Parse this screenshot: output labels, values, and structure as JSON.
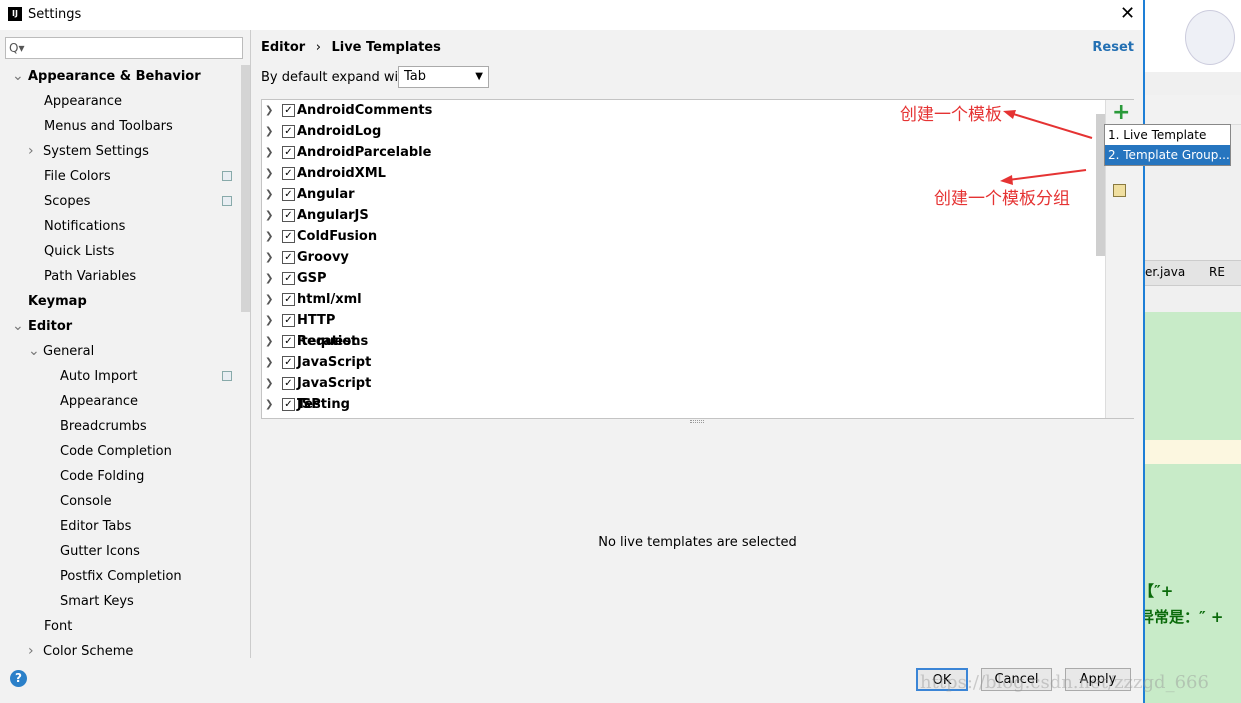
{
  "window": {
    "title": "Settings",
    "close": "✕"
  },
  "search": {
    "placeholder": "Q▾"
  },
  "sidebar": {
    "items": [
      {
        "label": "Appearance & Behavior",
        "level": 0,
        "bold": true,
        "arrow": "down"
      },
      {
        "label": "Appearance",
        "level": 1
      },
      {
        "label": "Menus and Toolbars",
        "level": 1
      },
      {
        "label": "System Settings",
        "level": 1,
        "arrow": "right"
      },
      {
        "label": "File Colors",
        "level": 1,
        "project": true
      },
      {
        "label": "Scopes",
        "level": 1,
        "project": true
      },
      {
        "label": "Notifications",
        "level": 1
      },
      {
        "label": "Quick Lists",
        "level": 1
      },
      {
        "label": "Path Variables",
        "level": 1
      },
      {
        "label": "Keymap",
        "level": 0,
        "bold": true
      },
      {
        "label": "Editor",
        "level": 0,
        "bold": true,
        "arrow": "down"
      },
      {
        "label": "General",
        "level": 1,
        "arrow": "down"
      },
      {
        "label": "Auto Import",
        "level": 2,
        "project": true
      },
      {
        "label": "Appearance",
        "level": 2
      },
      {
        "label": "Breadcrumbs",
        "level": 2
      },
      {
        "label": "Code Completion",
        "level": 2
      },
      {
        "label": "Code Folding",
        "level": 2
      },
      {
        "label": "Console",
        "level": 2
      },
      {
        "label": "Editor Tabs",
        "level": 2
      },
      {
        "label": "Gutter Icons",
        "level": 2
      },
      {
        "label": "Postfix Completion",
        "level": 2
      },
      {
        "label": "Smart Keys",
        "level": 2
      },
      {
        "label": "Font",
        "level": 1
      },
      {
        "label": "Color Scheme",
        "level": 1,
        "arrow": "right"
      }
    ]
  },
  "main": {
    "breadcrumb": [
      "Editor",
      "›",
      "Live Templates"
    ],
    "reset": "Reset",
    "expand_label": "By default expand with",
    "expand_value": "Tab",
    "groups": [
      "AndroidComments",
      "AndroidLog",
      "AndroidParcelable",
      "AndroidXML",
      "Angular",
      "AngularJS",
      "ColdFusion",
      "Groovy",
      "GSP",
      "html/xml",
      "HTTP Request",
      "iterations",
      "JavaScript",
      "JavaScript Testing",
      "JSP"
    ],
    "empty_text": "No live templates are selected"
  },
  "popup": {
    "items": [
      "1. Live Template",
      "2. Template Group..."
    ]
  },
  "annotations": {
    "create_template": "创建一个模板",
    "create_group": "创建一个模板分组"
  },
  "footer": {
    "ok": "OK",
    "cancel": "Cancel",
    "apply": "Apply",
    "help": "?"
  },
  "background": {
    "tab1": "er.java",
    "tab2": "RE",
    "code1": "【″+",
    "code2": "异常是：″ +"
  },
  "watermark": "https://blog.csdn.net/zzzgd_666",
  "colors": {
    "accent": "#2675bf",
    "annotation": "#e53333",
    "add": "#2a9a3a"
  }
}
